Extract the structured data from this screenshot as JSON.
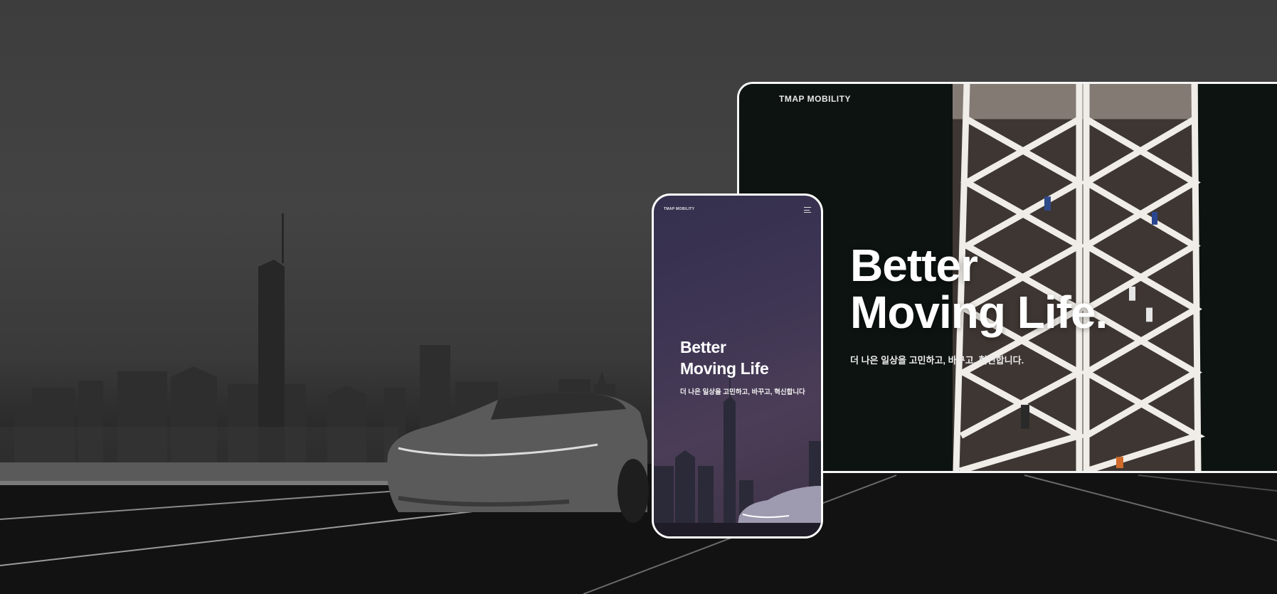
{
  "desktop": {
    "logo": "TMAP MOBILITY",
    "headline_line1": "Better",
    "headline_line2": "Moving Life.",
    "subtitle": "더 나은 일상을 고민하고, 바꾸고, 혁신합니다."
  },
  "mobile": {
    "logo": "TMAP MOBILITY",
    "menu_icon": "hamburger-menu-icon",
    "headline_line1": "Better",
    "headline_line2": "Moving Life",
    "subtitle": "더 나은 일상을 고민하고, 바꾸고, 혁신합니다"
  },
  "colors": {
    "device_frame": "#ffffff",
    "background_dark": "#1c1c1c",
    "mobile_gradient_top": "#34304e",
    "mobile_gradient_bottom": "#4b3d57",
    "desktop_bg": "#0b110f"
  }
}
